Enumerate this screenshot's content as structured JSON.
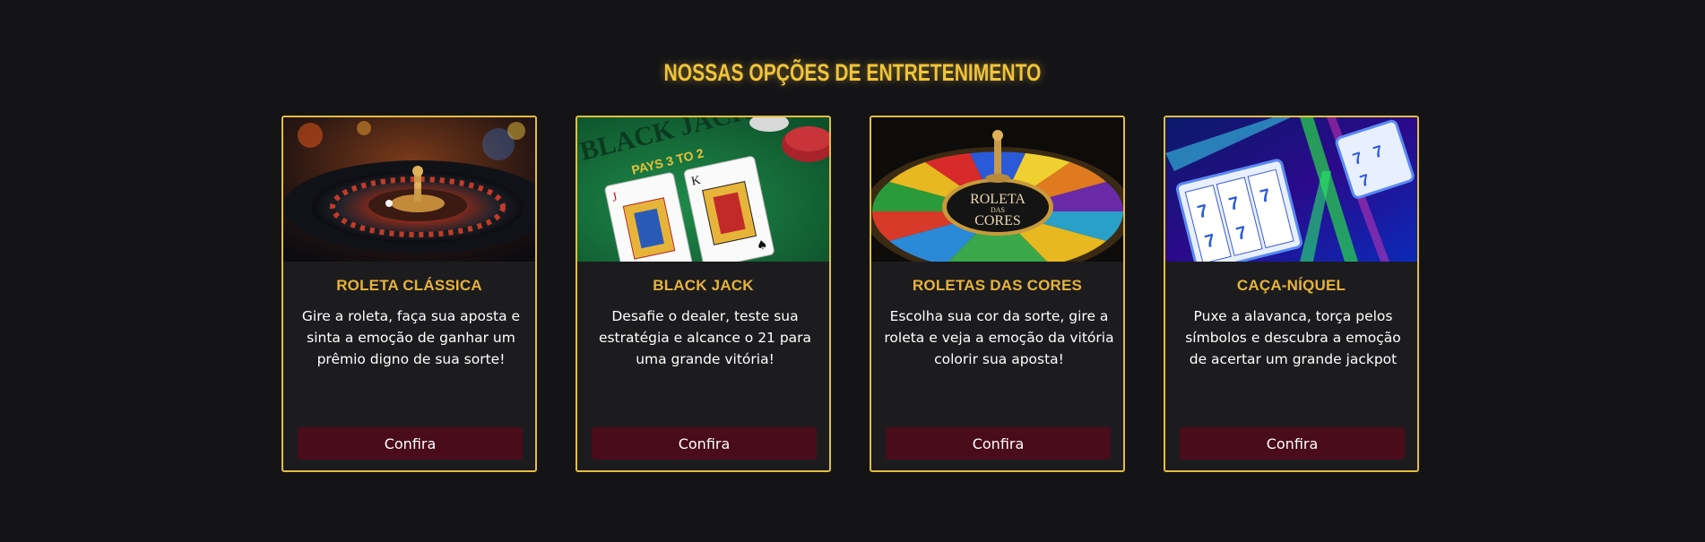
{
  "section": {
    "title": "NOSSAS OPÇÕES DE ENTRETENIMENTO"
  },
  "cards": [
    {
      "title": "ROLETA CLÁSSICA",
      "description": "Gire a roleta, faça sua aposta e sinta a emoção de ganhar um prêmio digno de sua sorte!",
      "button_label": "Confira",
      "image": "roulette-wheel-image"
    },
    {
      "title": "BLACK JACK",
      "description": "Desafie o dealer, teste sua estratégia e alcance o 21 para uma grande vitória!",
      "button_label": "Confira",
      "image": "blackjack-table-image",
      "image_text": {
        "table_label": "BLACK JACK",
        "payout": "PAYS 3 TO 2"
      }
    },
    {
      "title": "ROLETAS DAS CORES",
      "description": "Escolha sua cor da sorte, gire a roleta e veja a emoção da vitória colorir sua aposta!",
      "button_label": "Confira",
      "image": "color-wheel-image",
      "image_text": {
        "wheel_line1": "ROLETA",
        "wheel_line2": "DAS",
        "wheel_line3": "CORES"
      }
    },
    {
      "title": "CAÇA-NÍQUEL",
      "description": "Puxe a alavanca, torça pelos símbolos e descubra a emoção de acertar um grande jackpot",
      "button_label": "Confira",
      "image": "slot-machine-image"
    }
  ],
  "colors": {
    "background": "#141417",
    "accent_gold": "#f0c43a",
    "card_border": "#e3bd3f",
    "button_bg": "#4a0b1b"
  }
}
